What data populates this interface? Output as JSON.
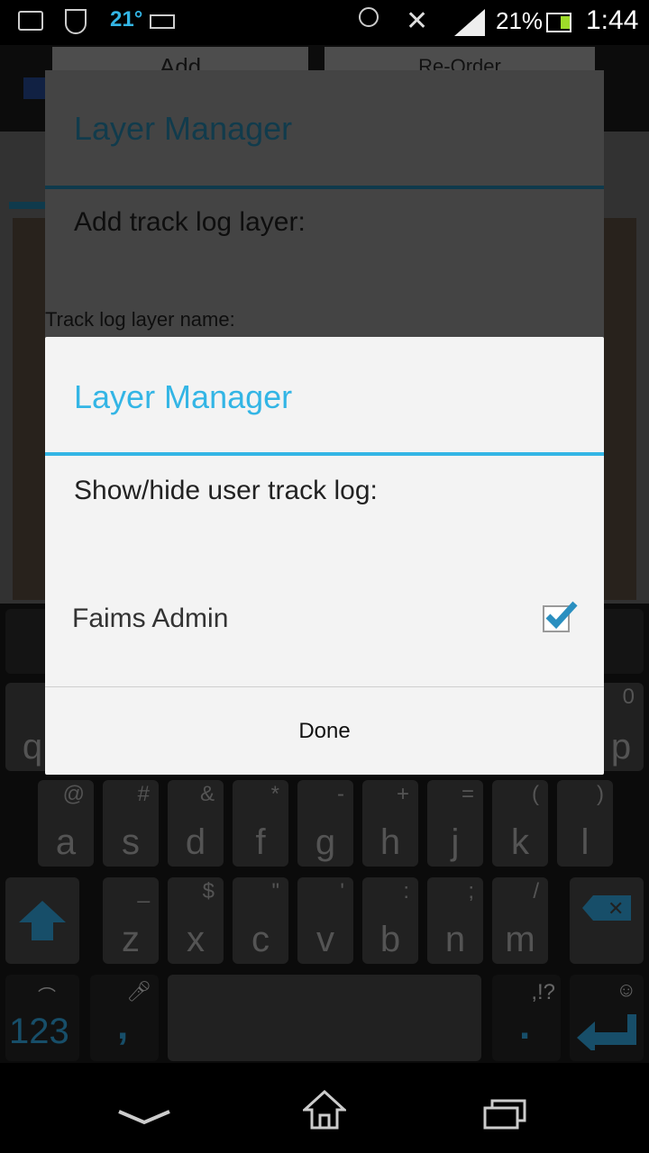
{
  "status_bar": {
    "temperature": "21°",
    "battery_percent": "21%",
    "time": "1:44"
  },
  "background_app": {
    "add_label": "Add",
    "reorder_label": "Re-Order"
  },
  "dialog_back": {
    "title": "Layer Manager",
    "message": "Add track log layer:",
    "field_label": "Track log layer name:"
  },
  "dialog_front": {
    "title": "Layer Manager",
    "message": "Show/hide user track log:",
    "item_label": "Faims Admin",
    "item_checked": true,
    "done_label": "Done"
  },
  "keyboard": {
    "row1": [
      {
        "main": "q"
      },
      {
        "main": "p",
        "sub": "0"
      }
    ],
    "row2": [
      {
        "main": "a",
        "sub": "@"
      },
      {
        "main": "s",
        "sub": "#"
      },
      {
        "main": "d",
        "sub": "&"
      },
      {
        "main": "f",
        "sub": "*"
      },
      {
        "main": "g",
        "sub": "-"
      },
      {
        "main": "h",
        "sub": "+"
      },
      {
        "main": "j",
        "sub": "="
      },
      {
        "main": "k",
        "sub": "("
      },
      {
        "main": "l",
        "sub": ")"
      }
    ],
    "row3": [
      {
        "main": "z",
        "sub": "_"
      },
      {
        "main": "x",
        "sub": "$"
      },
      {
        "main": "c",
        "sub": "\""
      },
      {
        "main": "v",
        "sub": "'"
      },
      {
        "main": "b",
        "sub": ":"
      },
      {
        "main": "n",
        "sub": ";"
      },
      {
        "main": "m",
        "sub": "/"
      }
    ],
    "numbers_label": "123",
    "comma_label": ",",
    "period_label": ".",
    "punct_hint": ",!?"
  },
  "colors": {
    "accent": "#33b5e5",
    "keyboard_accent": "#2a8fc0"
  }
}
